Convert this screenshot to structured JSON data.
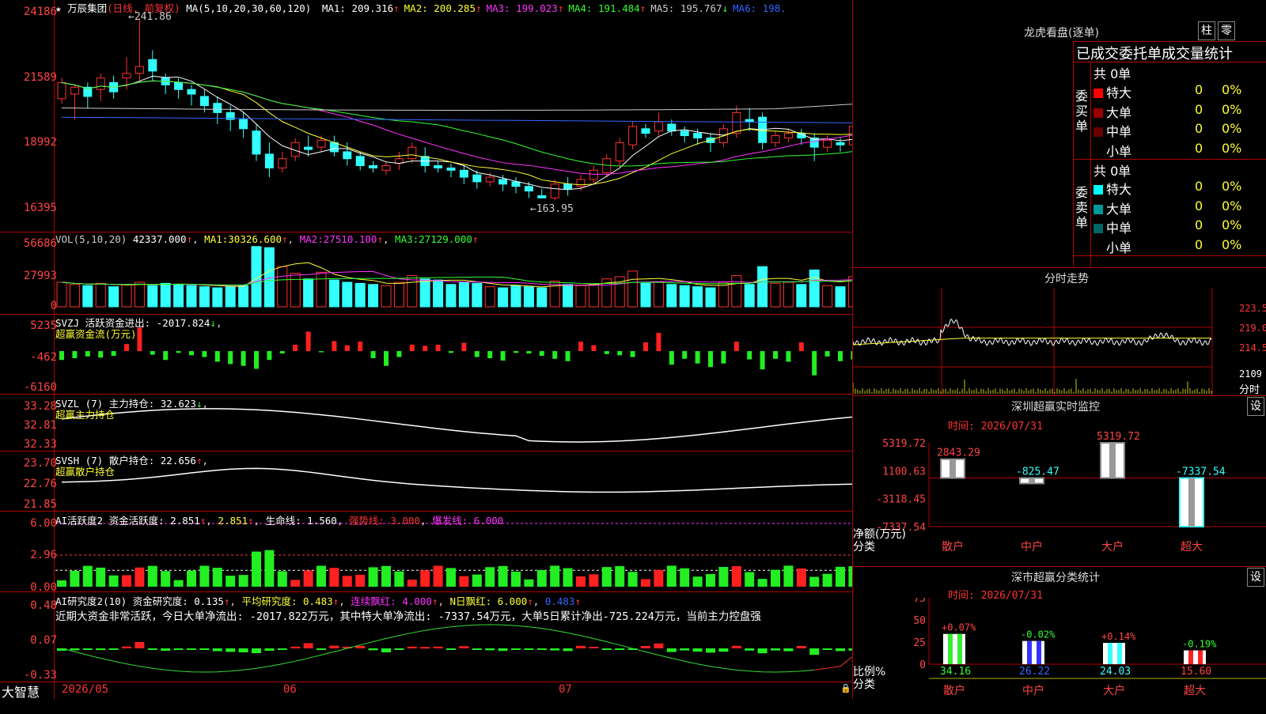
{
  "stock": {
    "name": "万辰集团",
    "period": "日线, 前复权"
  },
  "price_panel": {
    "ma_params": "MA(5,10,20,30,60,120)",
    "ma": [
      {
        "label": "MA1:",
        "value": "209.316",
        "color": "#ffffff"
      },
      {
        "label": "MA2:",
        "value": "200.285",
        "color": "#ffff33"
      },
      {
        "label": "MA3:",
        "value": "199.023",
        "color": "#ff33ff"
      },
      {
        "label": "MA4:",
        "value": "191.484",
        "color": "#33ff33"
      },
      {
        "label": "MA5:",
        "value": "195.767",
        "color": "#cccccc"
      },
      {
        "label": "MA6:",
        "value": "198.",
        "color": "#3366ff"
      }
    ],
    "ma_arrows": [
      "↑",
      "↑",
      "↑",
      "↑",
      "↓",
      ""
    ],
    "high_label": "241.86",
    "low_label": "163.95",
    "y_ticks": [
      "24186",
      "21589",
      "18992",
      "16395"
    ]
  },
  "vol_panel": {
    "label": "VOL(5,10,20)",
    "vol": "42337.000",
    "ma1": "30326.600",
    "ma2": "27510.100",
    "ma3": "27129.000",
    "ma1_label": "MA1:",
    "ma2_label": "MA2:",
    "ma3_label": "MA3:",
    "y_ticks": [
      "56686",
      "27993",
      "0"
    ]
  },
  "svzj_panel": {
    "label": "SVZJ  活跃资金进出: -2017.824",
    "sub": "超赢资金流(万元)",
    "y_ticks": [
      "5235",
      "-462",
      "-6160"
    ]
  },
  "svzl_panel": {
    "label": "SVZL (7) 主力持仓: 32.623",
    "sub": "超赢主力持仓",
    "y_ticks": [
      "33.28",
      "32.81",
      "32.33"
    ]
  },
  "svsh_panel": {
    "label": "SVSH (7) 散户持仓: 22.656",
    "sub": "超赢散户持仓",
    "y_ticks": [
      "23.70",
      "22.76",
      "21.85"
    ]
  },
  "ai1_panel": {
    "label": "AI活跃度2 资金活跃度: 2.851",
    "v2": "2.851",
    "life": "生命线: 1.560",
    "strong": "强势线: 3.000",
    "burst": "爆发线: 6.000",
    "y_ticks": [
      "6.00",
      "2.96",
      "0.00"
    ]
  },
  "ai2_panel": {
    "label": "AI研究度2(10) 资金研究度: 0.135",
    "avg": "平均研究度: 0.483",
    "red": "连续飘红: 4.000",
    "nred": "N日飘红: 6.000",
    "last": "0.483",
    "comment": "近期大资金非常活跃，今日大单净流出: -2017.822万元，其中特大单净流出: -7337.54万元，大单5日累计净出-725.224万元，当前主力控盘强",
    "y_ticks": [
      "0.48",
      "0.07",
      "-0.33"
    ]
  },
  "x_axis": {
    "labels": [
      "2026/05",
      "06",
      "07"
    ],
    "brand": "大智慧"
  },
  "dragon": {
    "title": "龙虎看盘(逐单)",
    "btn1": "柱",
    "btn2": "零",
    "header": "已成交委托单成交量统计",
    "buy_label": "委买单",
    "sell_label": "委卖单",
    "buy_total": "共 0单",
    "sell_total": "共 0单",
    "buy_rows": [
      {
        "name": "特大",
        "val": "0",
        "pct": "0%",
        "color": "#ff0000"
      },
      {
        "name": "大单",
        "val": "0",
        "pct": "0%",
        "color": "#990000"
      },
      {
        "name": "中单",
        "val": "0",
        "pct": "0%",
        "color": "#660000"
      },
      {
        "name": "小单",
        "val": "0",
        "pct": "0%",
        "color": "#000000"
      }
    ],
    "sell_rows": [
      {
        "name": "特大",
        "val": "0",
        "pct": "0%",
        "color": "#00ffff"
      },
      {
        "name": "大单",
        "val": "0",
        "pct": "0%",
        "color": "#009999"
      },
      {
        "name": "中单",
        "val": "0",
        "pct": "0%",
        "color": "#006666"
      },
      {
        "name": "小单",
        "val": "0",
        "pct": "0%",
        "color": "#000000"
      }
    ]
  },
  "intraday": {
    "title": "分时走势",
    "y_ticks": [
      "223.5",
      "219.0",
      "214.5",
      "2109"
    ],
    "unit": "分时"
  },
  "sz_monitor": {
    "title": "深圳超赢实时监控",
    "btn": "设",
    "time": "时间: 2026/07/31",
    "y_ticks": [
      "5319.72",
      "1100.63",
      "-3118.45",
      "-7337.54"
    ],
    "ylabel": "净额(万元)",
    "xlabel": "分类",
    "categories": [
      "散户",
      "中户",
      "大户",
      "超大"
    ],
    "values": [
      "2843.29",
      "-825.47",
      "5319.72",
      "-7337.54"
    ]
  },
  "sz_stats": {
    "title": "深市超赢分类统计",
    "btn": "设",
    "time": "时间: 2026/07/31",
    "y_ticks": [
      "75",
      "50",
      "25",
      "0"
    ],
    "ylabel": "比例%",
    "xlabel": "分类",
    "categories": [
      "散户",
      "中户",
      "大户",
      "超大"
    ],
    "changes": [
      "+0.07%",
      "-0.02%",
      "+0.14%",
      "-0.19%"
    ],
    "values": [
      "34.16",
      "26.22",
      "24.03",
      "15.60"
    ]
  },
  "chart_data": {
    "type": "candlestick",
    "ylim": [
      163.95,
      241.86
    ],
    "candles": [
      [
        207,
        214,
        205,
        216
      ],
      [
        209,
        212,
        198,
        213
      ],
      [
        212,
        208,
        203,
        214
      ],
      [
        211,
        216,
        206,
        218
      ],
      [
        214,
        210,
        207,
        217
      ],
      [
        216,
        218,
        211,
        225
      ],
      [
        218,
        221,
        214,
        241.86
      ],
      [
        224,
        219,
        215,
        228
      ],
      [
        216,
        213,
        209,
        218
      ],
      [
        214,
        211,
        207,
        216
      ],
      [
        211,
        209,
        204,
        213
      ],
      [
        208,
        204,
        201,
        211
      ],
      [
        205,
        201,
        196,
        208
      ],
      [
        201,
        198,
        193,
        204
      ],
      [
        198,
        194,
        190,
        201
      ],
      [
        193,
        183,
        180,
        196
      ],
      [
        183,
        177,
        173,
        188
      ],
      [
        177,
        181,
        175,
        184
      ],
      [
        182,
        188,
        180,
        190
      ],
      [
        186,
        185,
        182,
        191
      ],
      [
        186,
        189,
        184,
        191
      ],
      [
        188,
        184,
        182,
        191
      ],
      [
        184,
        181,
        178,
        188
      ],
      [
        182,
        178,
        176,
        184
      ],
      [
        178,
        177,
        175,
        180
      ],
      [
        176,
        178,
        174,
        180
      ],
      [
        179,
        181,
        176,
        184
      ],
      [
        181,
        186,
        179,
        188
      ],
      [
        182,
        178,
        175,
        186
      ],
      [
        178,
        177,
        175,
        180
      ],
      [
        177,
        176,
        173,
        179
      ],
      [
        176,
        173,
        170,
        178
      ],
      [
        174,
        171,
        168,
        176
      ],
      [
        171,
        173,
        169,
        175
      ],
      [
        172,
        170,
        167,
        174
      ],
      [
        171,
        169,
        166,
        173
      ],
      [
        169,
        167,
        164,
        171
      ],
      [
        165,
        164,
        163.95,
        168
      ],
      [
        164,
        170,
        163,
        172
      ],
      [
        170,
        168,
        165,
        173
      ],
      [
        169,
        172,
        167,
        174
      ],
      [
        172,
        176,
        170,
        178
      ],
      [
        175,
        181,
        173,
        183
      ],
      [
        180,
        188,
        178,
        190
      ],
      [
        187,
        195,
        185,
        197
      ],
      [
        194,
        192,
        190,
        196
      ],
      [
        193,
        197,
        191,
        201
      ],
      [
        196,
        193,
        191,
        198
      ],
      [
        193,
        191,
        188,
        195
      ],
      [
        192,
        190,
        187,
        194
      ],
      [
        190,
        188,
        184,
        192
      ],
      [
        188,
        194,
        186,
        196
      ],
      [
        192,
        201,
        190,
        204
      ],
      [
        198,
        197,
        193,
        203
      ],
      [
        199,
        188,
        185,
        201
      ],
      [
        188,
        191,
        186,
        193
      ],
      [
        190,
        192,
        188,
        194
      ],
      [
        192,
        190,
        187,
        194
      ],
      [
        190,
        186,
        180,
        192
      ],
      [
        186,
        189,
        184,
        191
      ],
      [
        188,
        187,
        184,
        190
      ],
      [
        187,
        195,
        185,
        199
      ],
      [
        195,
        203,
        193,
        206
      ],
      [
        203,
        209,
        201,
        214
      ],
      [
        208,
        204,
        200,
        212
      ]
    ],
    "volume": [
      22000,
      20000,
      19000,
      21000,
      18000,
      20000,
      22000,
      19000,
      21000,
      20000,
      19000,
      18000,
      17000,
      18000,
      19000,
      54000,
      53000,
      36000,
      30000,
      25000,
      31000,
      24000,
      22000,
      21000,
      20000,
      19000,
      22000,
      28000,
      25000,
      24000,
      20000,
      22000,
      21000,
      18000,
      17000,
      19000,
      18000,
      17000,
      23000,
      20000,
      19000,
      20000,
      25000,
      27000,
      32000,
      21000,
      22000,
      20000,
      19000,
      18000,
      17000,
      22000,
      28000,
      20000,
      36000,
      21000,
      22000,
      20000,
      33000,
      19000,
      18000,
      27000,
      32000,
      30000,
      42337
    ],
    "fund_flow": [
      -1500,
      -1200,
      -900,
      -1100,
      -800,
      1200,
      4000,
      -600,
      -1500,
      -300,
      -700,
      -1000,
      -1800,
      -2200,
      -2500,
      -3000,
      -1500,
      -400,
      1100,
      3300,
      -200,
      1700,
      1000,
      1600,
      -1200,
      -2500,
      -1000,
      1100,
      900,
      1100,
      -300,
      1400,
      -1000,
      -1200,
      -1600,
      -300,
      -400,
      -800,
      -1300,
      -1700,
      1600,
      1000,
      -500,
      -700,
      -1000,
      1500,
      3100,
      -2300,
      -1300,
      -2100,
      -2700,
      -2100,
      1600,
      -1400,
      -3100,
      -1300,
      -1800,
      1500,
      -4100,
      -900,
      -1700,
      -1400,
      -2600,
      2100,
      2400,
      4200,
      -2017.824
    ]
  }
}
